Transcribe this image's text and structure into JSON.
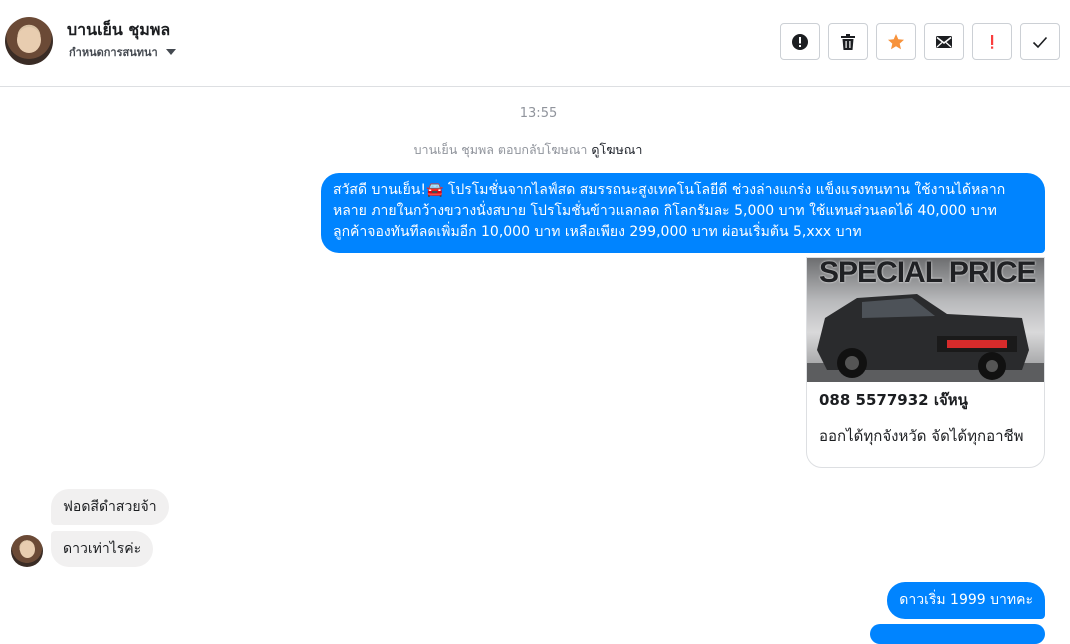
{
  "header": {
    "contact_name": "บานเย็น ชุมพล",
    "label_dropdown": "กำหนดการสนทนา",
    "actions": [
      {
        "name": "mark-spam-button",
        "icon": "exclamation-circle-icon"
      },
      {
        "name": "delete-button",
        "icon": "trash-icon"
      },
      {
        "name": "star-button",
        "icon": "star-icon",
        "color": "#f7923b"
      },
      {
        "name": "mark-unread-button",
        "icon": "envelope-icon"
      },
      {
        "name": "follow-up-button",
        "icon": "exclamation-icon",
        "color": "#fa3e3e"
      },
      {
        "name": "mark-done-button",
        "icon": "checkmark-icon"
      }
    ]
  },
  "conversation": {
    "timestamp": "13:55",
    "replied_text": "บานเย็น ชุมพล ตอบกลับโฆษณา",
    "replied_link": "ดูโฆษณา",
    "outgoing_1": "สวัสดี บานเย็น!🚘 โปรโมชั่นจากไลฟ์สด สมรรถนะสูงเทคโนโลยีดี ช่วงล่างแกร่ง แข็งแรงทนทาน ใช้งานได้หลากหลาย ภายในกว้างขวางนั่งสบาย โปรโมชั่นข้าวแลกลด กิโลกรัมละ 5,000 บาท ใช้แทนส่วนลดได้ 40,000 บาท ลูกค้าจองทันทีลดเพิ่มอีก 10,000 บาท เหลือเพียง 299,000 บาท ผ่อนเริ่มต้น 5,xxx บาท",
    "card": {
      "image_text": "SPECIAL PRICE",
      "title": "088 5577932 เจ๊หนู",
      "description": "ออกได้ทุกจังหวัด จัดได้ทุกอาชีพ"
    },
    "incoming_1": "ฟอดสีดำสวยจ้า",
    "incoming_2": "ดาวเท่าไรค่ะ",
    "outgoing_2": "ดาวเริ่ม 1999 บาทคะ"
  },
  "colors": {
    "outgoing_bubble": "#0084ff",
    "incoming_bubble": "#f1f0f0",
    "star": "#f7923b",
    "follow_up": "#fa3e3e"
  }
}
